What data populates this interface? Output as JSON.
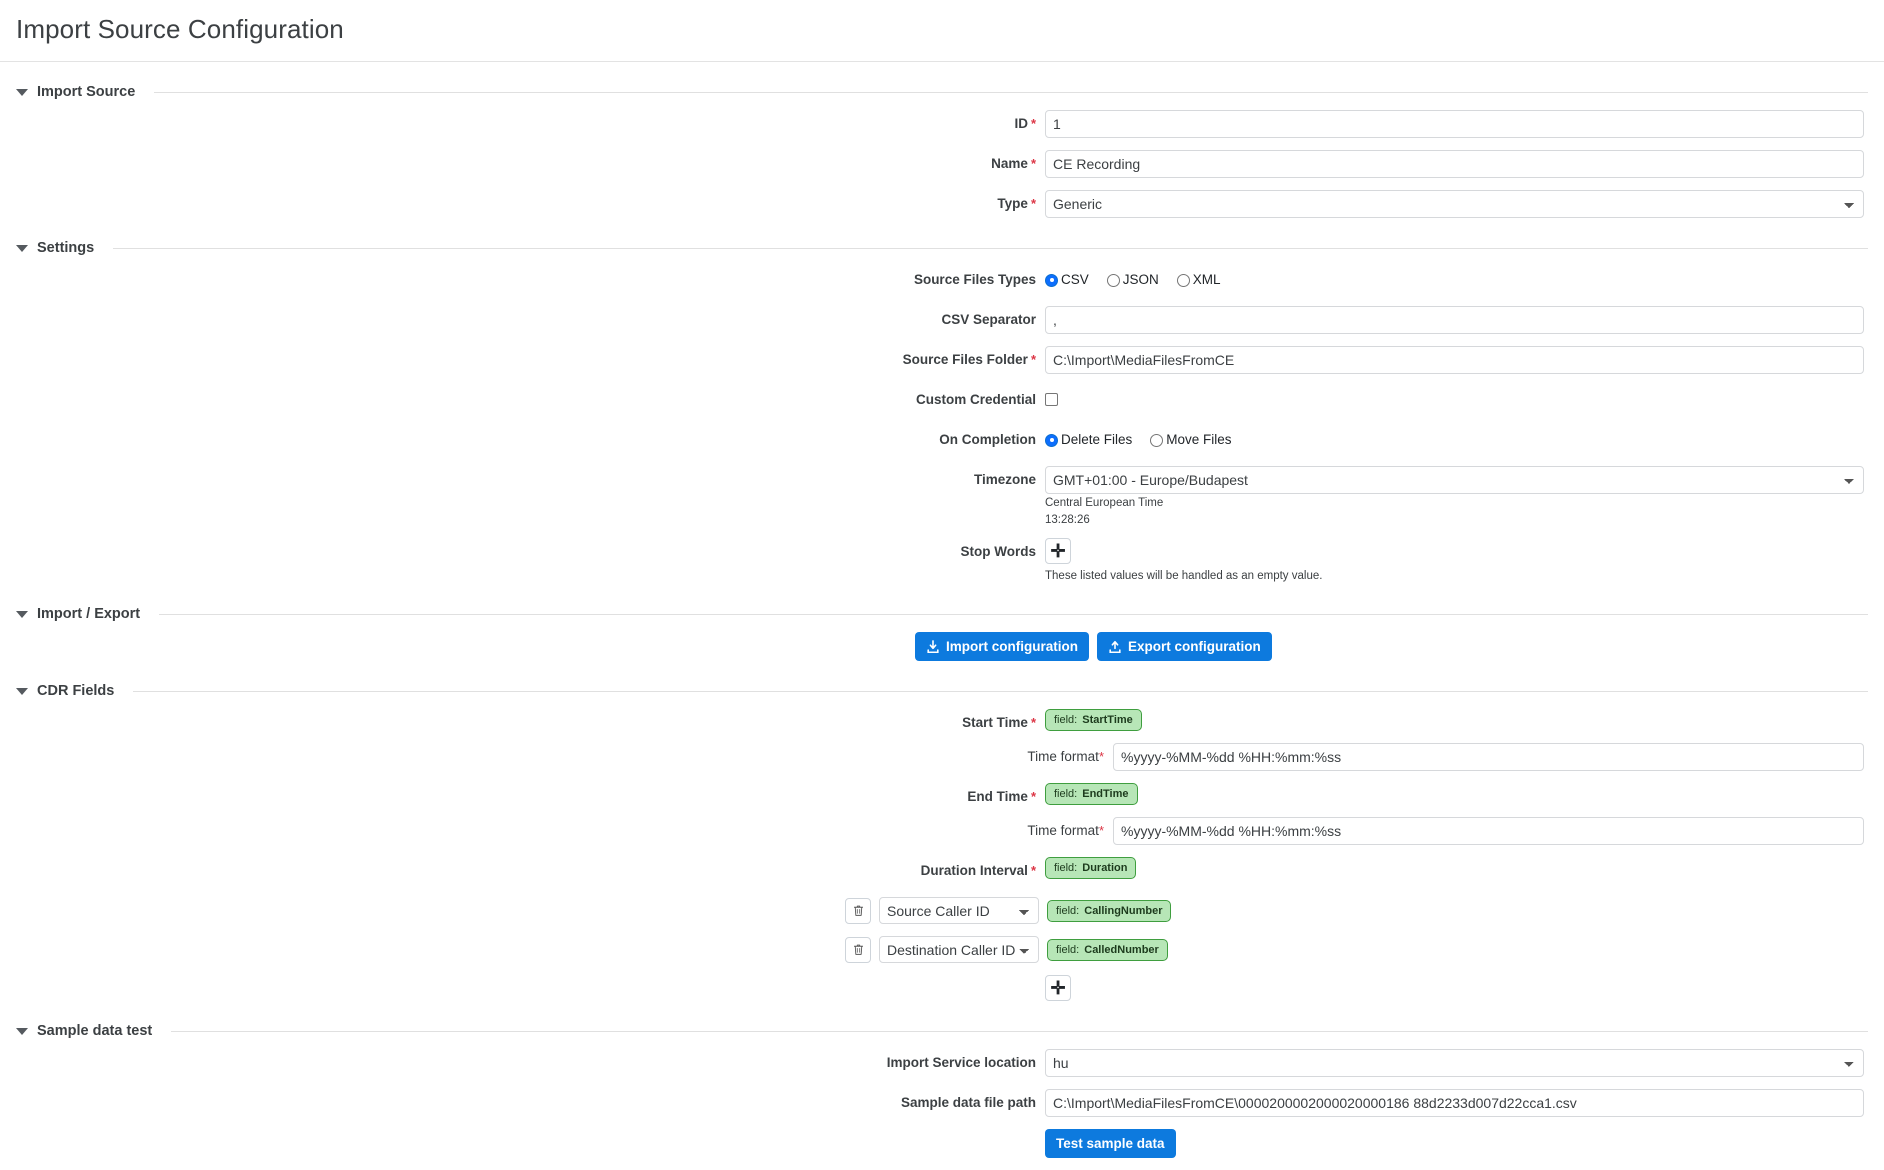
{
  "page": {
    "title": "Import Source Configuration"
  },
  "sections": {
    "import_source": {
      "label": "Import Source"
    },
    "settings": {
      "label": "Settings"
    },
    "import_export": {
      "label": "Import / Export"
    },
    "cdr_fields": {
      "label": "CDR Fields"
    },
    "sample_data_test": {
      "label": "Sample data test"
    }
  },
  "import_source": {
    "id": {
      "label": "ID",
      "value": "1"
    },
    "name": {
      "label": "Name",
      "value": "CE Recording"
    },
    "type": {
      "label": "Type",
      "value": "Generic"
    }
  },
  "settings": {
    "source_files_types": {
      "label": "Source Files Types",
      "options": [
        "CSV",
        "JSON",
        "XML"
      ],
      "selected": "CSV"
    },
    "csv_separator": {
      "label": "CSV Separator",
      "value": ","
    },
    "source_files_folder": {
      "label": "Source Files Folder",
      "value": "C:\\Import\\MediaFilesFromCE"
    },
    "custom_credential": {
      "label": "Custom Credential",
      "checked": false
    },
    "on_completion": {
      "label": "On Completion",
      "options": [
        "Delete Files",
        "Move Files"
      ],
      "selected": "Delete Files"
    },
    "timezone": {
      "label": "Timezone",
      "value": "GMT+01:00 - Europe/Budapest",
      "name_hint": "Central European Time",
      "time_hint": "13:28:26"
    },
    "stop_words": {
      "label": "Stop Words",
      "add_icon": "plus-icon",
      "hint": "These listed values will be handled as an empty value."
    }
  },
  "import_export": {
    "import_button": {
      "label": "Import configuration",
      "icon": "download-icon"
    },
    "export_button": {
      "label": "Export configuration",
      "icon": "upload-icon"
    }
  },
  "cdr_fields": {
    "start_time": {
      "label": "Start Time",
      "badge_key": "field:",
      "badge_value": "StartTime",
      "time_format_label": "Time format",
      "time_format_value": "%yyyy-%MM-%dd %HH:%mm:%ss"
    },
    "end_time": {
      "label": "End Time",
      "badge_key": "field:",
      "badge_value": "EndTime",
      "time_format_label": "Time format",
      "time_format_value": "%yyyy-%MM-%dd %HH:%mm:%ss"
    },
    "duration_interval": {
      "label": "Duration Interval",
      "badge_key": "field:",
      "badge_value": "Duration"
    },
    "mappings": [
      {
        "delete_icon": "trash-icon",
        "select_value": "Source Caller ID",
        "badge_key": "field:",
        "badge_value": "CallingNumber"
      },
      {
        "delete_icon": "trash-icon",
        "select_value": "Destination Caller ID",
        "badge_key": "field:",
        "badge_value": "CalledNumber"
      }
    ],
    "add_icon": "plus-icon"
  },
  "sample_data_test": {
    "import_service_location": {
      "label": "Import Service location",
      "value": "hu"
    },
    "sample_data_file_path": {
      "label": "Sample data file path",
      "value": "C:\\Import\\MediaFilesFromCE\\0000200002000020000186 88d2233d007d22cca1.csv"
    },
    "test_button": {
      "label": "Test sample data"
    }
  },
  "colors": {
    "accent_blue": "#0d7ade",
    "badge_green_bg": "#b7e6b7",
    "badge_green_border": "#3f9e3f",
    "required_red": "#dc3545"
  }
}
